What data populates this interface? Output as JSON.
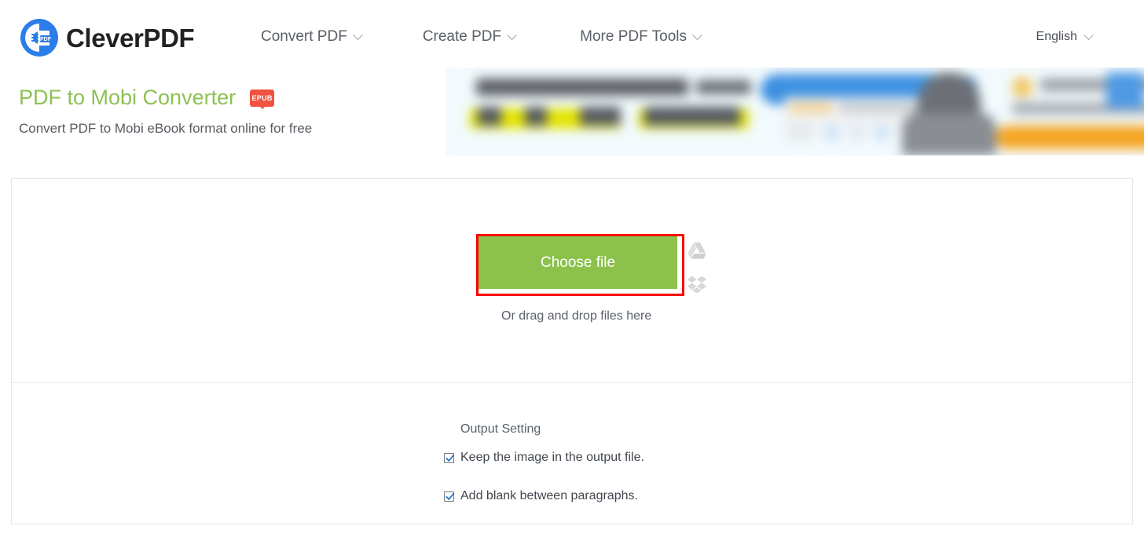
{
  "header": {
    "brand_name": "CleverPDF",
    "logo_icon": "cleverpdf-logo-icon",
    "nav": [
      {
        "label": "Convert PDF",
        "icon": "chevron-down-icon"
      },
      {
        "label": "Create PDF",
        "icon": "chevron-down-icon"
      },
      {
        "label": "More PDF Tools",
        "icon": "chevron-down-icon"
      }
    ],
    "language": {
      "label": "English",
      "icon": "chevron-down-icon"
    }
  },
  "hero": {
    "title": "PDF to Mobi Converter",
    "badge": "EPUB",
    "subtitle": "Convert PDF to Mobi eBook format online for free"
  },
  "banner": {
    "alt": "blurred advertisement banner"
  },
  "upload": {
    "choose_file_label": "Choose file",
    "drag_drop_text": "Or drag and drop files here",
    "google_drive_icon": "google-drive-icon",
    "dropbox_icon": "dropbox-icon",
    "highlight_color": "#ff0000",
    "button_color": "#8cc14c"
  },
  "output_settings": {
    "title": "Output Setting",
    "options": [
      {
        "label": "Keep the image in the output file.",
        "checked": true
      },
      {
        "label": "Add blank between paragraphs.",
        "checked": true
      }
    ]
  },
  "colors": {
    "accent_green": "#8cc153",
    "badge_red": "#ef5340",
    "logo_blue": "#2b7de9"
  }
}
